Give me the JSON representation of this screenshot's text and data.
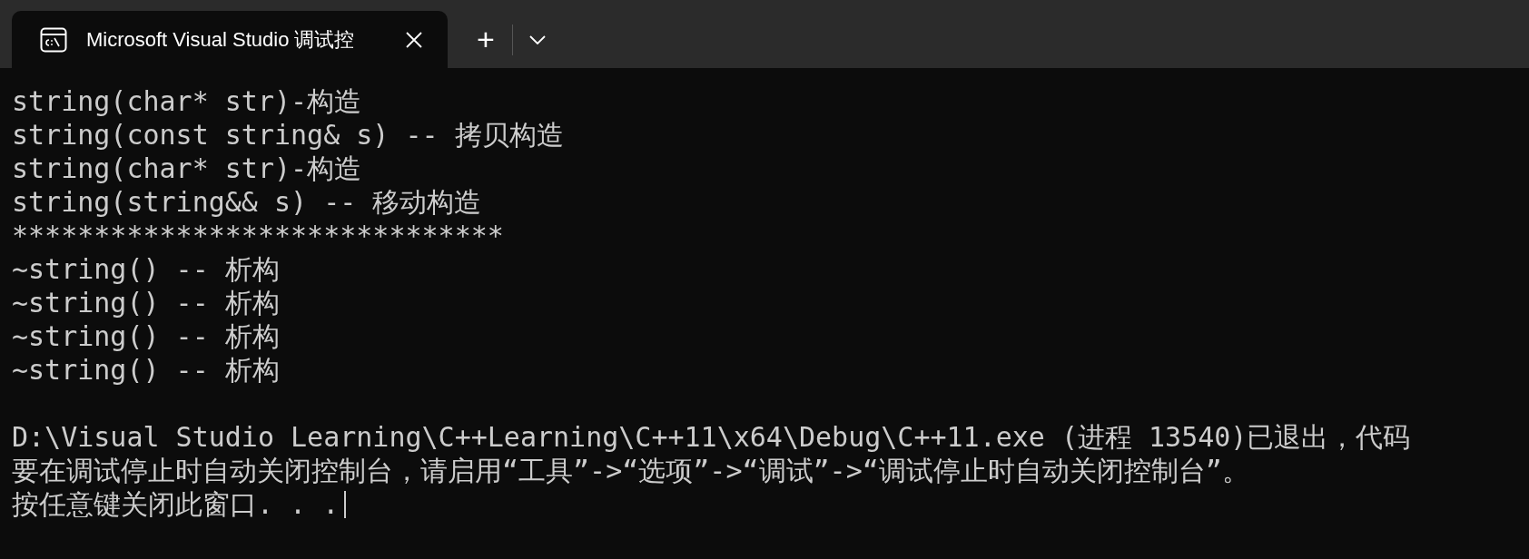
{
  "tabs": [
    {
      "title": "Microsoft Visual Studio 调试控",
      "selected": true
    }
  ],
  "tab_bar": {
    "new_tab": "+"
  },
  "console": {
    "lines": [
      "string(char* str)-构造",
      "string(const string& s) -- 拷贝构造",
      "string(char* str)-构造",
      "string(string&& s) -- 移动构造",
      "******************************",
      "~string() -- 析构",
      "~string() -- 析构",
      "~string() -- 析构",
      "~string() -- 析构"
    ],
    "exit_lines": [
      "D:\\Visual Studio Learning\\C++Learning\\C++11\\x64\\Debug\\C++11.exe (进程 13540)已退出，代码",
      "要在调试停止时自动关闭控制台，请启用“工具”->“选项”->“调试”->“调试停止时自动关闭控制台”。",
      "按任意键关闭此窗口. . ."
    ],
    "cursor_visible": true
  }
}
